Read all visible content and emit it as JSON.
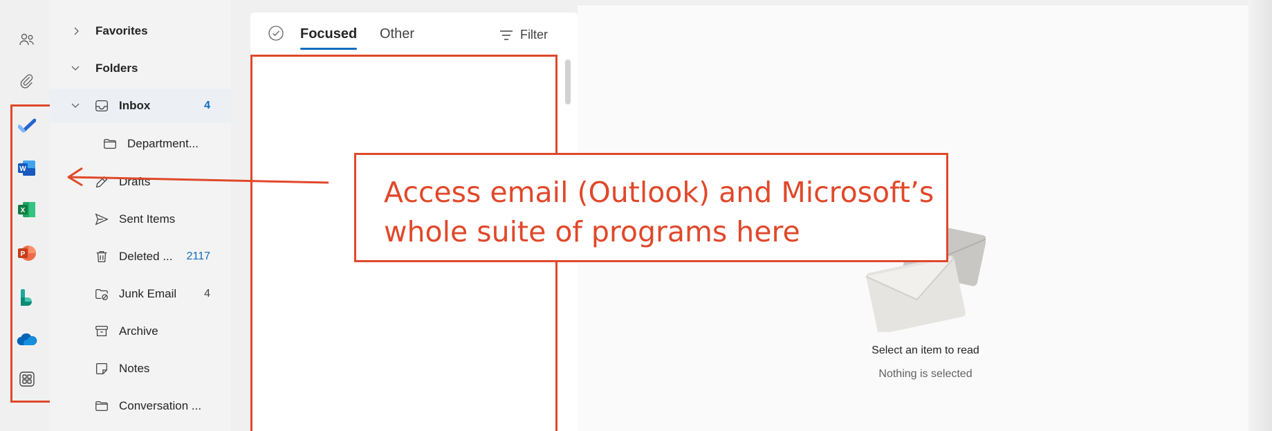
{
  "rail": {
    "items": [
      {
        "name": "people",
        "icon": "people-icon"
      },
      {
        "name": "attachments",
        "icon": "paperclip-icon"
      },
      {
        "name": "to-do",
        "icon": "todo-check-icon",
        "color": "#2564cf"
      },
      {
        "name": "word",
        "icon": "word-icon",
        "color": "#185abd",
        "letter": "W"
      },
      {
        "name": "excel",
        "icon": "excel-icon",
        "color": "#107c41",
        "letter": "X"
      },
      {
        "name": "powerpoint",
        "icon": "powerpoint-icon",
        "color": "#c43e1c",
        "letter": "P"
      },
      {
        "name": "bookings",
        "icon": "bookings-icon",
        "color": "#0d8a76"
      },
      {
        "name": "onedrive",
        "icon": "onedrive-icon",
        "color": "#0364b8"
      },
      {
        "name": "more-apps",
        "icon": "apps-grid-icon"
      }
    ]
  },
  "folders": {
    "favorites_label": "Favorites",
    "folders_label": "Folders",
    "items": [
      {
        "label": "Inbox",
        "count": "4",
        "icon": "inbox-icon"
      },
      {
        "label": "Department...",
        "count": "",
        "icon": "folder-icon"
      },
      {
        "label": "Drafts",
        "count": "",
        "icon": "pencil-icon"
      },
      {
        "label": "Sent Items",
        "count": "",
        "icon": "send-icon"
      },
      {
        "label": "Deleted ...",
        "count": "2117",
        "icon": "trash-icon"
      },
      {
        "label": "Junk Email",
        "count": "4",
        "icon": "junk-folder-icon"
      },
      {
        "label": "Archive",
        "count": "",
        "icon": "archive-icon"
      },
      {
        "label": "Notes",
        "count": "",
        "icon": "note-icon"
      },
      {
        "label": "Conversation ...",
        "count": "",
        "icon": "folder-icon"
      }
    ]
  },
  "list": {
    "tabs": [
      {
        "label": "Focused",
        "selected": true
      },
      {
        "label": "Other",
        "selected": false
      }
    ],
    "filter_label": "Filter"
  },
  "reading_pane": {
    "empty_title": "Select an item to read",
    "empty_subtitle": "Nothing is selected"
  },
  "annotation": {
    "line1": "Access email (Outlook) and Microsoft’s",
    "line2": "whole suite of programs here",
    "color": "#e0482a"
  },
  "colors": {
    "accent": "#0f6cbd",
    "annotation": "#e0482a"
  }
}
